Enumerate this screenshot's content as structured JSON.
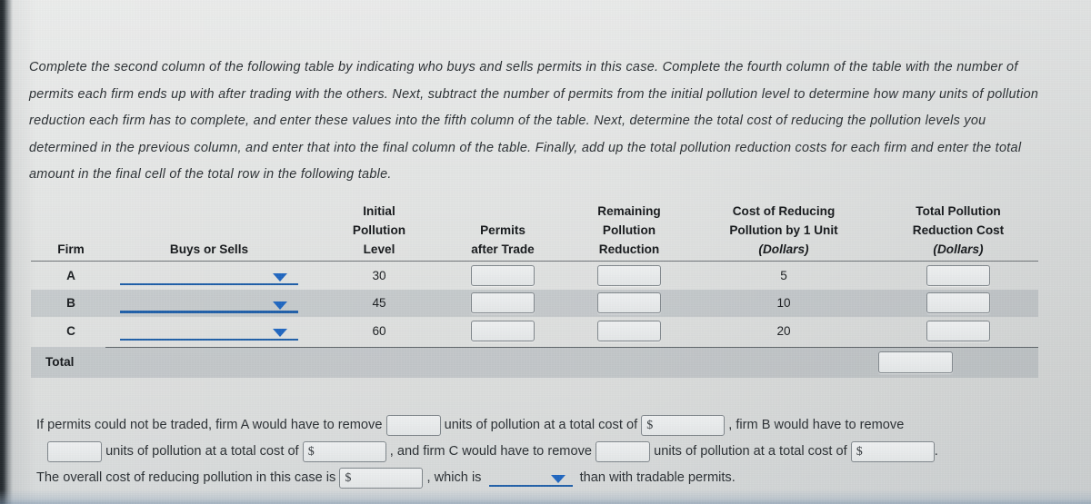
{
  "instructions": {
    "text": "Complete the second column of the following table by indicating who buys and sells permits in this case. Complete the fourth column of the table with the number of permits each firm ends up with after trading with the others. Next, subtract the number of permits from the initial pollution level to determine how many units of pollution reduction each firm has to complete, and enter these values into the fifth column of the table. Next, determine the total cost of reducing the pollution levels you determined in the previous column, and enter that into the final column of the table. Finally, add up the total pollution reduction costs for each firm and enter the total amount in the final cell of the total row in the following table."
  },
  "table": {
    "headers": {
      "firm": "Firm",
      "buys_or_sells": "Buys or Sells",
      "initial_l1": "Initial",
      "initial_l2": "Pollution",
      "initial_l3": "Level",
      "permits_l1": "Permits",
      "permits_l2": "after Trade",
      "remaining_l1": "Remaining",
      "remaining_l2": "Pollution",
      "remaining_l3": "Reduction",
      "cost_l1": "Cost of Reducing",
      "cost_l2": "Pollution by 1 Unit",
      "cost_l3": "(Dollars)",
      "totalcost_l1": "Total Pollution",
      "totalcost_l2": "Reduction Cost",
      "totalcost_l3": "(Dollars)"
    },
    "rows": [
      {
        "firm": "A",
        "buys_or_sells": "",
        "initial_level": "30",
        "permits_after_trade": "",
        "remaining_reduction": "",
        "unit_cost": "5",
        "total_cost": ""
      },
      {
        "firm": "B",
        "buys_or_sells": "",
        "initial_level": "45",
        "permits_after_trade": "",
        "remaining_reduction": "",
        "unit_cost": "10",
        "total_cost": ""
      },
      {
        "firm": "C",
        "buys_or_sells": "",
        "initial_level": "60",
        "permits_after_trade": "",
        "remaining_reduction": "",
        "unit_cost": "20",
        "total_cost": ""
      }
    ],
    "total_row": {
      "label": "Total",
      "total_cost": ""
    }
  },
  "bottom": {
    "line1_a": "If permits could not be traded, firm A would have to remove",
    "line1_b": "units of pollution at a total cost of",
    "line1_c": ", firm B would have to remove",
    "line2_a": "units of pollution at a total cost of",
    "line2_b": ", and firm C would have to remove",
    "line2_c": "units of pollution at a total cost of",
    "line2_d": ".",
    "line3_a": "The overall cost of reducing pollution in this case is",
    "line3_b": ", which is",
    "line3_c": "than with tradable permits.",
    "currency_symbol": "$",
    "fields": {
      "a_units": "",
      "a_cost": "",
      "b_units": "",
      "b_cost": "",
      "c_units": "",
      "c_cost": "",
      "overall_cost": "",
      "comparison": ""
    }
  },
  "colors": {
    "accent_blue": "#1f66c0",
    "underline_blue": "#1f5fa8",
    "row_shade": "#8c969e",
    "text": "#2a2f33",
    "page_bg": "#dcdedd"
  }
}
